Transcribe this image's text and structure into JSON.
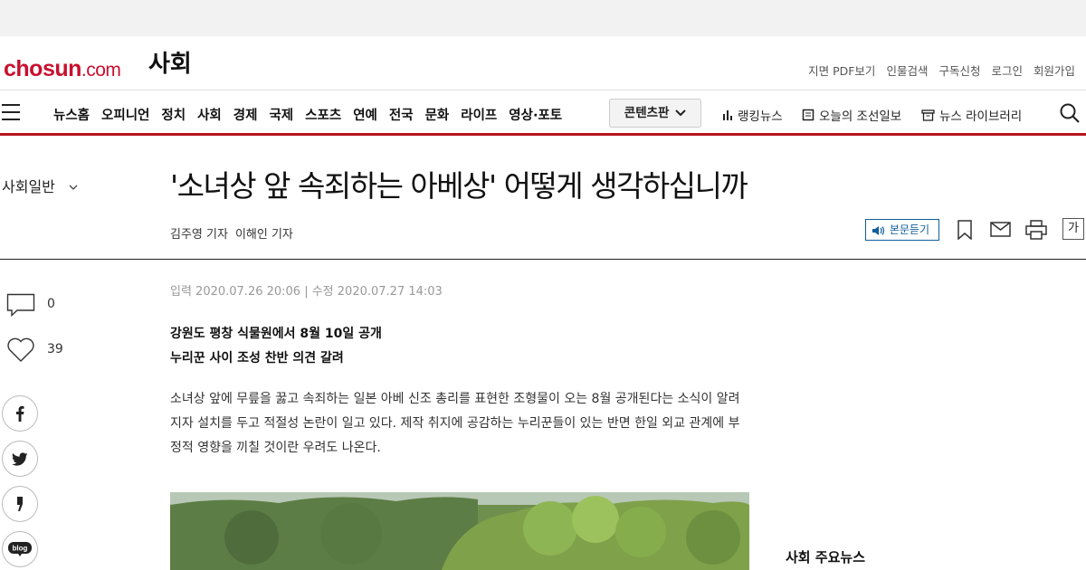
{
  "header": {
    "logo_main": "chosun",
    "logo_suffix": ".com",
    "section": "사회",
    "util_links": [
      "지면 PDF보기",
      "인물검색",
      "구독신청",
      "로그인",
      "회원가입"
    ]
  },
  "nav": {
    "items": [
      "뉴스홈",
      "오피니언",
      "정치",
      "사회",
      "경제",
      "국제",
      "스포츠",
      "연예",
      "전국",
      "문화",
      "라이프",
      "영상·포토"
    ],
    "content_button": "콘텐츠판",
    "quick": [
      {
        "label": "랭킹뉴스",
        "icon": "chart-icon"
      },
      {
        "label": "오늘의 조선일보",
        "icon": "newspaper-icon"
      },
      {
        "label": "뉴스 라이브러리",
        "icon": "archive-icon"
      }
    ]
  },
  "article": {
    "category": "사회일반",
    "headline": "'소녀상 앞 속죄하는 아베상' 어떻게 생각하십니까",
    "reporters": [
      "김주영 기자",
      "이해인 기자"
    ],
    "listen_label": "본문듣기",
    "font_size_label": "가",
    "dates": "입력 2020.07.26 20:06 | 수정 2020.07.27 14:03",
    "subheads": [
      "강원도 평창 식물원에서 8월 10일 공개",
      "누리꾼 사이 조성 찬반 의견 갈려"
    ],
    "body": "소녀상 앞에 무릎을 꿇고 속죄하는 일본 아베 신조 총리를 표현한 조형물이 오는 8월 공개된다는 소식이 알려지자 설치를 두고 적절성 논란이 일고 있다. 제작 취지에 공감하는 누리꾼들이 있는 반면 한일 외교 관계에 부정적 영향을 끼칠 것이란 우려도 나온다."
  },
  "rail": {
    "comment_count": "0",
    "like_count": "39"
  },
  "sidebar": {
    "title": "사회 주요뉴스"
  },
  "colors": {
    "brand_red": "#c8102e",
    "nav_rule": "#b8141e",
    "listen_blue": "#0f5e9c"
  }
}
